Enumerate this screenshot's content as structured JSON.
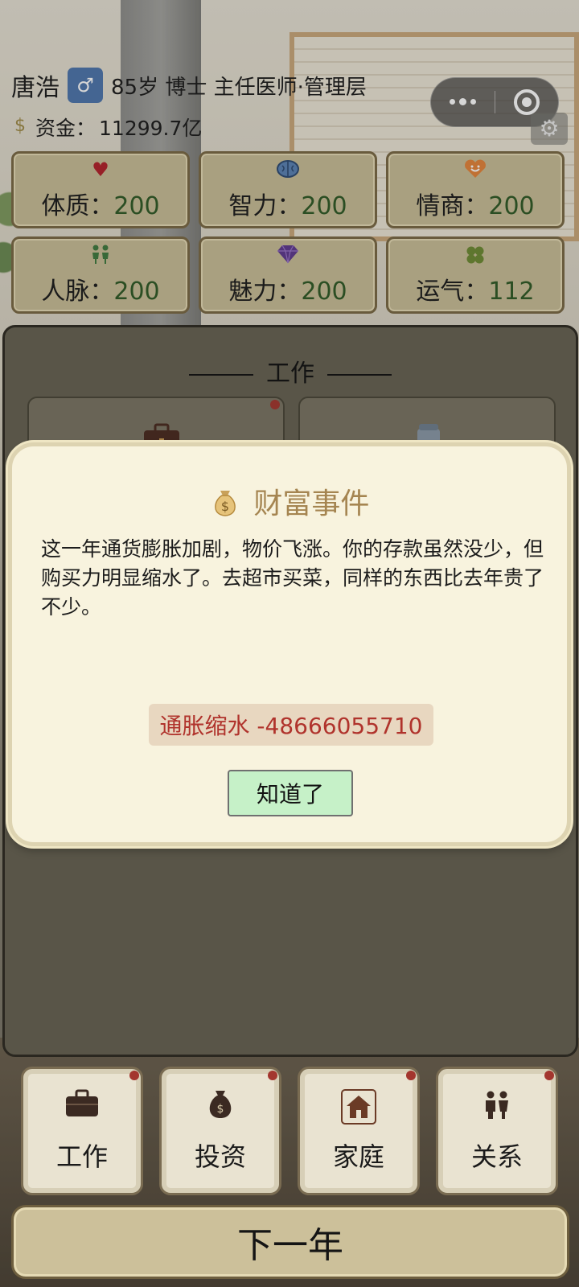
{
  "player": {
    "name": "唐浩",
    "gender_symbol": "♂",
    "profile": "85岁 博士 主任医师·管理层",
    "money_label": "资金：",
    "money_value": "11299.7亿"
  },
  "miniprogram_capsule": {
    "more_icon": "more-dots-icon",
    "close_icon": "target-circle-icon"
  },
  "stats": [
    {
      "label": "体质：",
      "value": "200",
      "icon": "heart-icon",
      "color": "#b3212a"
    },
    {
      "label": "智力：",
      "value": "200",
      "icon": "brain-icon",
      "color": "#3c5f8d"
    },
    {
      "label": "情商：",
      "value": "200",
      "icon": "smile-heart-icon",
      "color": "#d4792f"
    },
    {
      "label": "人脉：",
      "value": "200",
      "icon": "people-icon",
      "color": "#3f7a3f"
    },
    {
      "label": "魅力：",
      "value": "200",
      "icon": "diamond-icon",
      "color": "#5e3a8f"
    },
    {
      "label": "运气：",
      "value": "112",
      "icon": "clover-icon",
      "color": "#5b7a2d"
    }
  ],
  "work_panel": {
    "title": "工作"
  },
  "dialog": {
    "title": "财富事件",
    "icon": "money-bag-icon",
    "body": "这一年通货膨胀加剧，物价飞涨。你的存款虽然没少，但购买力明显缩水了。去超市买菜，同样的东西比去年贵了不少。",
    "effect": "通胀缩水 -48666055710",
    "confirm_label": "知道了"
  },
  "bottom_nav": [
    {
      "label": "工作",
      "icon": "briefcase-icon"
    },
    {
      "label": "投资",
      "icon": "money-sack-icon"
    },
    {
      "label": "家庭",
      "icon": "house-icon"
    },
    {
      "label": "关系",
      "icon": "couple-icon"
    }
  ],
  "next_year_label": "下一年"
}
